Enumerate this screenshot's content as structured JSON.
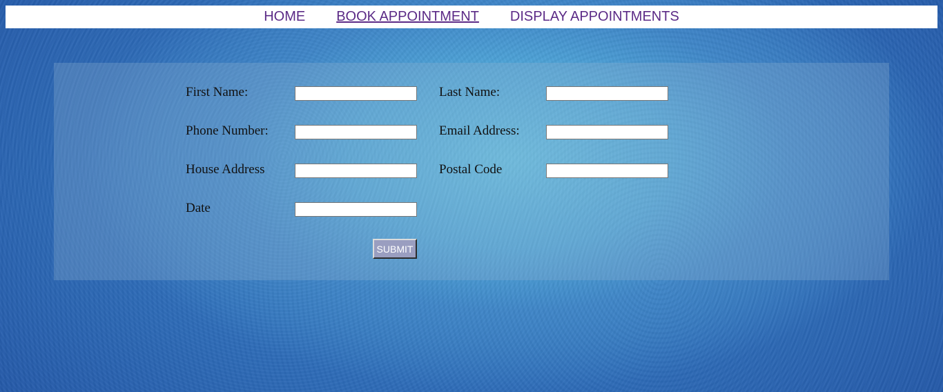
{
  "nav": {
    "home": "HOME",
    "book": "BOOK APPOINTMENT",
    "display": "DISPLAY APPOINTMENTS",
    "active": "book"
  },
  "form": {
    "first_name": {
      "label": "First Name:",
      "value": ""
    },
    "last_name": {
      "label": "Last Name:",
      "value": ""
    },
    "phone": {
      "label": "Phone Number:",
      "value": ""
    },
    "email": {
      "label": "Email Address:",
      "value": ""
    },
    "house_address": {
      "label": "House Address",
      "value": ""
    },
    "postal_code": {
      "label": "Postal Code",
      "value": ""
    },
    "date": {
      "label": "Date",
      "value": ""
    },
    "submit_label": "SUBMIT"
  },
  "colors": {
    "nav_link": "#5b2a86",
    "submit_bg": "#9a9ec0",
    "background": "#2e6cb8"
  }
}
